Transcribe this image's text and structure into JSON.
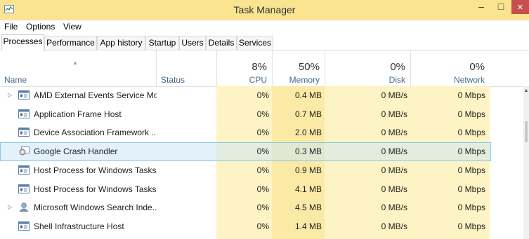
{
  "window": {
    "title": "Task Manager",
    "minimize": "–",
    "maximize": "□",
    "close": "✕"
  },
  "menu": [
    "File",
    "Options",
    "View"
  ],
  "tabs": [
    "Processes",
    "Performance",
    "App history",
    "Startup",
    "Users",
    "Details",
    "Services"
  ],
  "active_tab": "Processes",
  "columns": {
    "name": "Name",
    "status": "Status",
    "cpu": {
      "label": "CPU",
      "percent": "8%"
    },
    "memory": {
      "label": "Memory",
      "percent": "50%"
    },
    "disk": {
      "label": "Disk",
      "percent": "0%"
    },
    "network": {
      "label": "Network",
      "percent": "0%"
    }
  },
  "processes": [
    {
      "name": "AMD External Events Service Mo...",
      "status": "",
      "cpu": "0%",
      "memory": "0.4 MB",
      "disk": "0 MB/s",
      "network": "0 Mbps",
      "expandable": true,
      "icon": "service-window-icon"
    },
    {
      "name": "Application Frame Host",
      "status": "",
      "cpu": "0%",
      "memory": "0.7 MB",
      "disk": "0 MB/s",
      "network": "0 Mbps",
      "expandable": false,
      "icon": "service-window-icon"
    },
    {
      "name": "Device Association Framework ...",
      "status": "",
      "cpu": "0%",
      "memory": "2.0 MB",
      "disk": "0 MB/s",
      "network": "0 Mbps",
      "expandable": false,
      "icon": "service-window-icon"
    },
    {
      "name": "Google Crash Handler",
      "status": "",
      "cpu": "0%",
      "memory": "0.3 MB",
      "disk": "0 MB/s",
      "network": "0 Mbps",
      "expandable": false,
      "icon": "gear-window-icon",
      "selected": true
    },
    {
      "name": "Host Process for Windows Tasks",
      "status": "",
      "cpu": "0%",
      "memory": "0.9 MB",
      "disk": "0 MB/s",
      "network": "0 Mbps",
      "expandable": false,
      "icon": "service-window-icon"
    },
    {
      "name": "Host Process for Windows Tasks",
      "status": "",
      "cpu": "0%",
      "memory": "4.1 MB",
      "disk": "0 MB/s",
      "network": "0 Mbps",
      "expandable": false,
      "icon": "service-window-icon"
    },
    {
      "name": "Microsoft Windows Search Inde...",
      "status": "",
      "cpu": "0%",
      "memory": "4.5 MB",
      "disk": "0 MB/s",
      "network": "0 Mbps",
      "expandable": true,
      "icon": "search-user-icon"
    },
    {
      "name": "Shell Infrastructure Host",
      "status": "",
      "cpu": "0%",
      "memory": "1.4 MB",
      "disk": "0 MB/s",
      "network": "0 Mbps",
      "expandable": false,
      "icon": "service-window-icon"
    }
  ],
  "colors": {
    "titlebar": "#fae490",
    "cpu_fill": "#fdf3c4",
    "memory_fill": "#fbe9a6",
    "disk_fill": "#fdf3c4",
    "network_fill": "#fdf3c4",
    "selection": "#cce8f6",
    "close": "#c74f50"
  }
}
